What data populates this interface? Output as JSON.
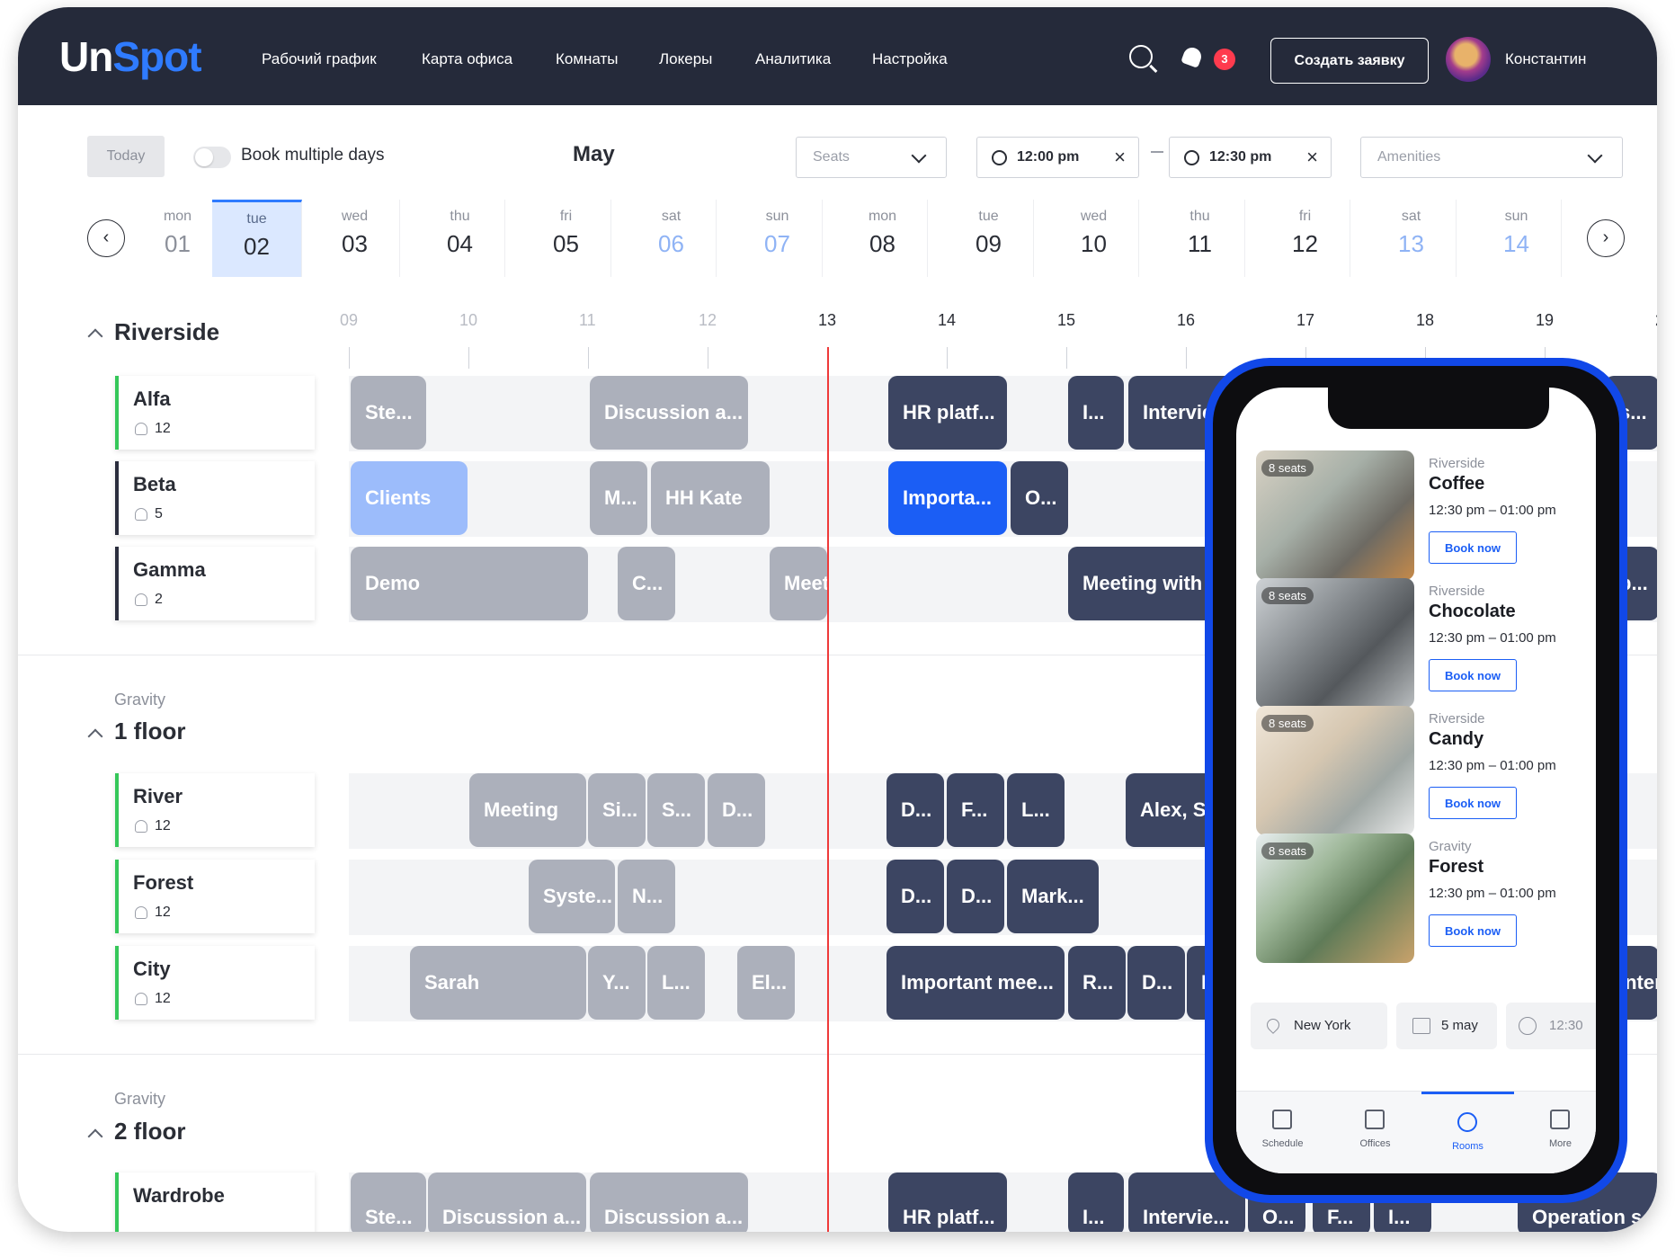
{
  "app": {
    "logo_a": "Un",
    "logo_b": "Spot"
  },
  "nav": [
    "Рабочий график",
    "Карта офиса",
    "Комнаты",
    "Локеры",
    "Аналитика",
    "Настройка"
  ],
  "header": {
    "notifications": "3",
    "create_button": "Создать заявку",
    "user": "Константин"
  },
  "toolbar": {
    "today": "Today",
    "book_multiple": "Book multiple days",
    "month": "May",
    "seats_placeholder": "Seats",
    "time_from": "12:00 pm",
    "time_to": "12:30 pm",
    "amenities_placeholder": "Amenities"
  },
  "days": [
    {
      "name": "mon",
      "num": "01"
    },
    {
      "name": "tue",
      "num": "02"
    },
    {
      "name": "wed",
      "num": "03"
    },
    {
      "name": "thu",
      "num": "04"
    },
    {
      "name": "fri",
      "num": "05"
    },
    {
      "name": "sat",
      "num": "06"
    },
    {
      "name": "sun",
      "num": "07"
    },
    {
      "name": "mon",
      "num": "08"
    },
    {
      "name": "tue",
      "num": "09"
    },
    {
      "name": "wed",
      "num": "10"
    },
    {
      "name": "thu",
      "num": "11"
    },
    {
      "name": "fri",
      "num": "12"
    },
    {
      "name": "sat",
      "num": "13"
    },
    {
      "name": "sun",
      "num": "14"
    }
  ],
  "hours": [
    "09",
    "10",
    "11",
    "12",
    "13",
    "14",
    "15",
    "16",
    "17",
    "18",
    "19",
    "2"
  ],
  "groups": [
    {
      "subtitle": "",
      "title": "Riverside",
      "rooms": [
        {
          "name": "Alfa",
          "capacity": "12"
        },
        {
          "name": "Beta",
          "capacity": "5"
        },
        {
          "name": "Gamma",
          "capacity": "2"
        }
      ]
    },
    {
      "subtitle": "Gravity",
      "title": "1 floor",
      "rooms": [
        {
          "name": "River",
          "capacity": "12"
        },
        {
          "name": "Forest",
          "capacity": "12"
        },
        {
          "name": "City",
          "capacity": "12"
        }
      ]
    },
    {
      "subtitle": "Gravity",
      "title": "2 floor",
      "rooms": [
        {
          "name": "Wardrobe",
          "capacity": ""
        }
      ]
    }
  ],
  "events": {
    "alfa": [
      "Ste...",
      "Discussion a...",
      "HR platf...",
      "I...",
      "Intervie",
      "s..."
    ],
    "beta": [
      "Clients",
      "M...",
      "HH Kate",
      "Importa...",
      "O..."
    ],
    "gamma": [
      "Demo",
      "C...",
      "Meet",
      "Meeting with",
      "p..."
    ],
    "river": [
      "Meeting",
      "Si...",
      "S...",
      "D...",
      "D...",
      "F...",
      "L...",
      "Alex, Sa"
    ],
    "forest": [
      "Syste...",
      "N...",
      "D...",
      "D...",
      "Mark..."
    ],
    "city": [
      "Sarah",
      "Y...",
      "L...",
      "El...",
      "Important mee...",
      "R...",
      "D...",
      "M",
      "Inter"
    ],
    "wardrobe": [
      "Ste...",
      "Discussion a...",
      "Discussion a...",
      "HR platf...",
      "I...",
      "Intervie...",
      "O...",
      "F...",
      "I...",
      "Operation s"
    ]
  },
  "mobile": {
    "cards": [
      {
        "seats": "8 seats",
        "location": "Riverside",
        "name": "Coffee",
        "time": "12:30 pm – 01:00 pm",
        "button": "Book now"
      },
      {
        "seats": "8 seats",
        "location": "Riverside",
        "name": "Chocolate",
        "time": "12:30 pm – 01:00 pm",
        "button": "Book now"
      },
      {
        "seats": "8 seats",
        "location": "Riverside",
        "name": "Candy",
        "time": "12:30 pm – 01:00 pm",
        "button": "Book now"
      },
      {
        "seats": "8 seats",
        "location": "Gravity",
        "name": "Forest",
        "time": "12:30 pm – 01:00 pm",
        "button": "Book now"
      }
    ],
    "filters": {
      "city": "New York",
      "date": "5 may",
      "time": "12:30"
    },
    "tabs": [
      "Schedule",
      "Offices",
      "Rooms",
      "More"
    ]
  }
}
